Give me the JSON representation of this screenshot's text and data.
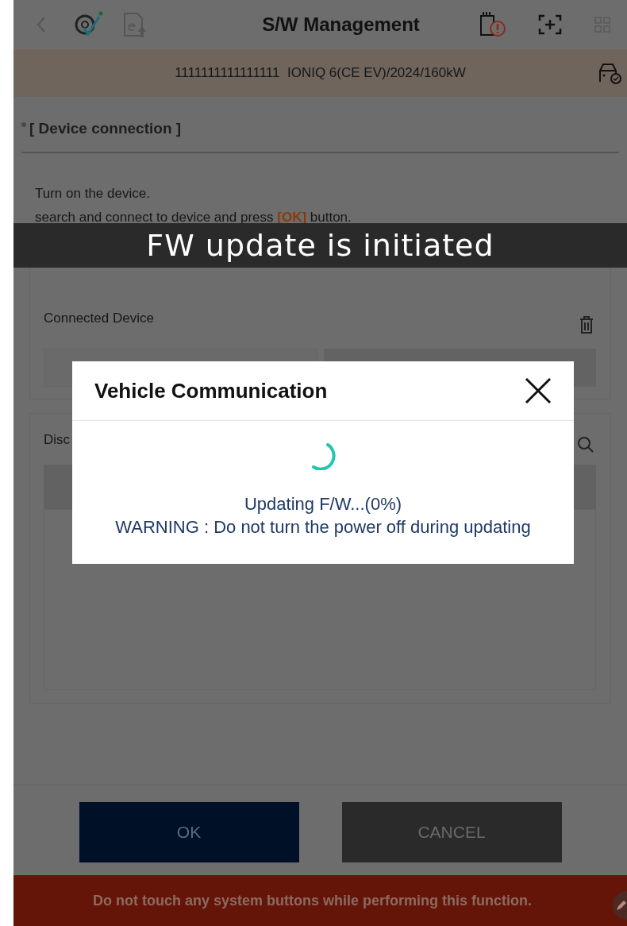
{
  "header": {
    "title": "S/W Management"
  },
  "vehicle_bar": {
    "text": "1111111111111111  IONIQ 6(CE EV)/2024/160kW"
  },
  "section": {
    "title": "[ Device connection ]"
  },
  "instructions": {
    "line_1": "Turn on the device.",
    "line_2": {
      "before": "search and connect to device and press ",
      "key": "[OK]",
      "after": " button."
    }
  },
  "toast": {
    "text": "FW update is initiated"
  },
  "connected_device": {
    "label": "Connected Device"
  },
  "discovered": {
    "label": "Disc"
  },
  "dialog": {
    "title": "Vehicle Communication",
    "progress_text": "Updating F/W...(0%)",
    "warning": "WARNING : Do not turn the power off during updating"
  },
  "buttons": [
    {
      "label": "OK",
      "kind": "primary"
    },
    {
      "label": "CANCEL",
      "kind": "secondary"
    }
  ],
  "footer_warning": "Do not touch any system buttons while performing this function."
}
